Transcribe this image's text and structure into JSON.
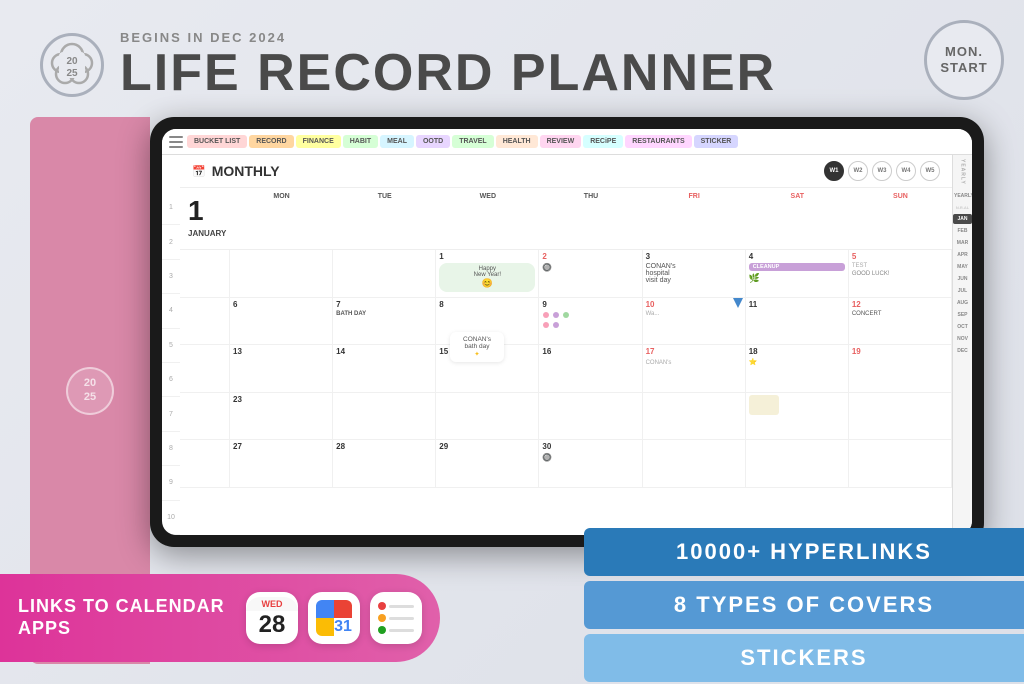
{
  "header": {
    "subtitle": "BEGINS IN DEC 2024",
    "title": "LIFE RECORD PLANNER",
    "logo_year_top": "20",
    "logo_year_bottom": "25",
    "mon_start": "MON.\nSTART"
  },
  "tablet": {
    "tabs": [
      {
        "label": "BUCKET LIST",
        "class": "tab-bucket"
      },
      {
        "label": "RECORD",
        "class": "tab-record"
      },
      {
        "label": "FINANCE",
        "class": "tab-finance"
      },
      {
        "label": "HABIT",
        "class": "tab-habit"
      },
      {
        "label": "MEAL",
        "class": "tab-meal"
      },
      {
        "label": "OOTD",
        "class": "tab-ootd"
      },
      {
        "label": "TRAVEL",
        "class": "tab-travel"
      },
      {
        "label": "HEALTH",
        "class": "tab-health"
      },
      {
        "label": "REVIEW",
        "class": "tab-review"
      },
      {
        "label": "RECiPE",
        "class": "tab-recipe"
      },
      {
        "label": "RESTAURANTS",
        "class": "tab-restaurants"
      },
      {
        "label": "STICKER",
        "class": "tab-sticker"
      }
    ],
    "calendar": {
      "title": "MONTHLY",
      "weeks": [
        "W1",
        "W2",
        "W3",
        "W4",
        "W5"
      ],
      "active_week": "W1",
      "days": [
        "MON",
        "TUE",
        "WED",
        "THU",
        "FRI",
        "SAT",
        "SUN"
      ],
      "month_num": "1",
      "month_name": "JANUARY"
    },
    "yearly_months": [
      "YEARLY",
      "YEARLY",
      "JAN",
      "FEB",
      "MAR",
      "APR",
      "MAY",
      "JUN",
      "JUL",
      "AUG",
      "SEP",
      "OCT",
      "NOV",
      "DEC"
    ],
    "row_numbers": [
      "1",
      "2",
      "3",
      "4",
      "5",
      "6",
      "7",
      "8",
      "9",
      "10"
    ]
  },
  "links_section": {
    "text": "LINKS TO\nCALENDAR APPS",
    "app_date_day": "WED",
    "app_date_num": "28"
  },
  "badges": {
    "hyperlinks": "10000+ HYPERLINKS",
    "covers": "8 TYPES OF COVERS",
    "stickers": "STICKERS"
  },
  "left_cover": {
    "year_top": "20",
    "year_bottom": "25"
  }
}
